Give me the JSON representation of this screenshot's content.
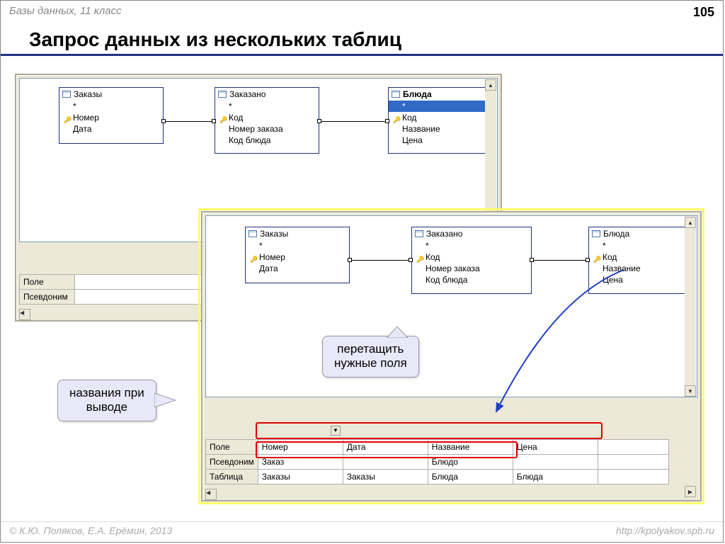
{
  "header": {
    "crumb": "Базы данных, 11 класс",
    "page": "105"
  },
  "title": "Запрос данных из нескольких таблиц",
  "footer": {
    "left": "© К.Ю. Поляков, Е.А. Ерёмин, 2013",
    "right": "http://kpolyakov.spb.ru"
  },
  "back": {
    "tables": [
      {
        "name": "Заказы",
        "rows": [
          "*",
          "Номер",
          "Дата"
        ],
        "keys": [
          false,
          true,
          false
        ]
      },
      {
        "name": "Заказано",
        "rows": [
          "*",
          "Код",
          "Номер заказа",
          "Код блюда"
        ],
        "keys": [
          false,
          true,
          false,
          false
        ]
      },
      {
        "name": "Блюда",
        "rows": [
          "*",
          "Код",
          "Название",
          "Цена"
        ],
        "keys": [
          false,
          true,
          false,
          false
        ],
        "bold": true,
        "sel": 0
      }
    ],
    "gridHeaders": [
      "Поле",
      "Псевдоним"
    ]
  },
  "front": {
    "tables": [
      {
        "name": "Заказы",
        "rows": [
          "*",
          "Номер",
          "Дата"
        ],
        "keys": [
          false,
          true,
          false
        ]
      },
      {
        "name": "Заказано",
        "rows": [
          "*",
          "Код",
          "Номер заказа",
          "Код блюда"
        ],
        "keys": [
          false,
          true,
          false,
          false
        ]
      },
      {
        "name": "Блюда",
        "rows": [
          "*",
          "Код",
          "Название",
          "Цена"
        ],
        "keys": [
          false,
          true,
          false,
          false
        ]
      }
    ],
    "grid": {
      "rowLabels": [
        "Поле",
        "Псевдоним",
        "Таблица"
      ],
      "cols": [
        [
          "Номер",
          "Заказ",
          "Заказы"
        ],
        [
          "Дата",
          "",
          "Заказы"
        ],
        [
          "Название",
          "Блюдо",
          "Блюда"
        ],
        [
          "Цена",
          "",
          "Блюда"
        ]
      ]
    }
  },
  "callouts": {
    "drag": "перетащить\nнужные поля",
    "alias": "названия при\nвыводе"
  }
}
